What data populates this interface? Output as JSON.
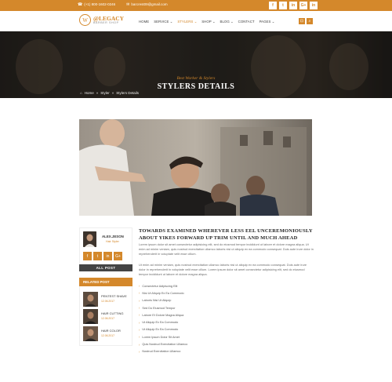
{
  "topbar": {
    "phone": "(+1) 800-1602-0246",
    "email": "barcrest09@gmail.com",
    "socials": [
      "f",
      "t",
      "in",
      "G+",
      "in"
    ]
  },
  "header": {
    "logo_text": "@LEGACY",
    "logo_tag": "BARBER SHOP",
    "nav": [
      "HOME",
      "SERVICE",
      "STYLERS",
      "SHOP",
      "BLOG",
      "CONTACT",
      "PAGES"
    ],
    "icons": [
      "cart-icon",
      "search-icon"
    ]
  },
  "hero": {
    "subtitle": "Best Worker & Stylers",
    "title": "STYLERS DETAILS",
    "breadcrumb": [
      "Home",
      "Styler",
      "Stylers Details"
    ]
  },
  "profile": {
    "name": "ALEX.JESON",
    "role": "Hair Styler",
    "socials": [
      "f",
      "t",
      "in",
      "G+"
    ],
    "all_post_label": "ALL POST"
  },
  "related": {
    "heading": "RELATED POST",
    "items": [
      {
        "title": "PENTEST SHAVE",
        "date": "12.06.2017"
      },
      {
        "title": "HAIR CUTTING",
        "date": "12.06.2017"
      },
      {
        "title": "HAIR COLOR",
        "date": "12.06.2017"
      }
    ]
  },
  "article": {
    "title": "TOWARDS EXAMINED WHEREVER LESS EEL UNCEREMONIOUSLY ABOUT YIKES FORWARD UP TRIM UNTIL AND MUCH AHEAD",
    "para1": "Lorem ipsum dolor sit amet consectetur adipisicing elit, sed do eiusmod tempor incididunt ut labore et dolore magna aliqua. Ut enim ad minim veniam, quis nostrud exercitation ullamco laboris nisi ut aliquip ex ea commodo consequat. Duis aute irure dolor in reprehenderit in voluptate velit esse cillum.",
    "para2": "Ut enim ad minim veniam, quis nostrud exercitation ullamco laboris nisi ut aliquip ex ea commodo consequat. Duis aute irure dolor in reprehenderit in voluptate velit esse cillum. Lorem ipsum dolor sit amet consectetur adipisicing elit, sed do eiusmod tempor incididunt ut labore et dolore magna aliqua.",
    "list": [
      "Consectetur Adipiscing Elit",
      "Nisi Ut Aliquip Ex Ea Commodo",
      "Laboris Nisi Ut Aliquip",
      "Sed Do Eiusmod Tempor",
      "Labore Et Dolore Magna Aliqua",
      "Ut Aliquip Ex Ea Commodo",
      "Ut Aliquip Ex Ea Commodo",
      "Lorem Ipsum Dolor Sit Amet",
      "Quis Nostrud Exercitation Ullamco",
      "Nostrud Exercitation Ullamco"
    ]
  },
  "colors": {
    "accent": "#d4882b",
    "dark": "#444444"
  }
}
